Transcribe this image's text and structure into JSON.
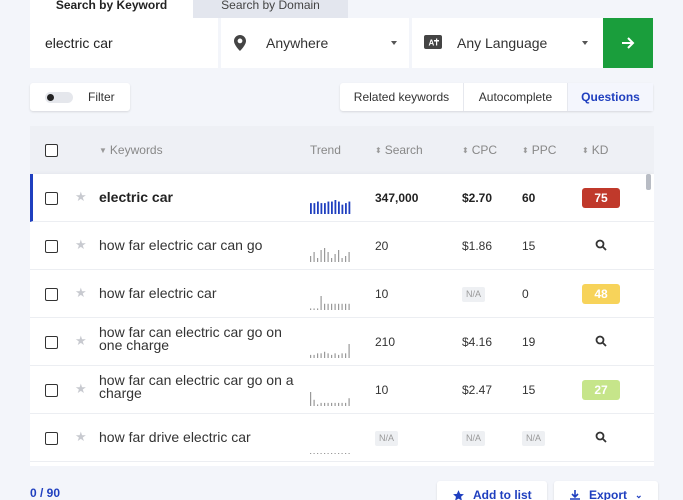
{
  "tabs": {
    "active": "Search by Keyword",
    "inactive": "Search by Domain"
  },
  "search": {
    "keyword_value": "electric car",
    "location": "Anywhere",
    "language": "Any Language"
  },
  "icons": {
    "location": "map-pin-icon",
    "language": "translate-icon",
    "go": "arrow-right-icon",
    "star": "star-icon",
    "search": "magnifier-icon",
    "add": "star-icon",
    "export": "download-icon"
  },
  "colors": {
    "go_button": "#1a9e3c",
    "accent": "#1f3fbf"
  },
  "filter": {
    "label": "Filter"
  },
  "modes": [
    "Related keywords",
    "Autocomplete",
    "Questions"
  ],
  "modes_selected": "Questions",
  "table": {
    "headers": {
      "keywords": "Keywords",
      "trend": "Trend",
      "search": "Search",
      "cpc": "CPC",
      "ppc": "PPC",
      "kd": "KD"
    },
    "rows": [
      {
        "keyword": "electric car",
        "search": "347,000",
        "cpc": "$2.70",
        "ppc": "60",
        "kd": "75",
        "kd_color": "#c0392b",
        "trend": [
          7,
          7,
          8,
          7,
          7,
          8,
          8,
          9,
          8,
          6,
          7,
          8
        ]
      },
      {
        "keyword": "how far electric car can go",
        "search": "20",
        "cpc": "$1.86",
        "ppc": "15",
        "kd": "",
        "kd_color": "",
        "trend": [
          3,
          5,
          2,
          6,
          7,
          5,
          2,
          4,
          6,
          2,
          3,
          5
        ]
      },
      {
        "keyword": "how far electric car",
        "search": "10",
        "cpc": "N/A",
        "ppc": "0",
        "kd": "48",
        "kd_color": "#f7d35a",
        "trend": [
          1,
          1,
          1,
          9,
          4,
          4,
          4,
          4,
          4,
          4,
          4,
          4
        ]
      },
      {
        "keyword": "how far can electric car go on one charge",
        "search": "210",
        "cpc": "$4.16",
        "ppc": "19",
        "kd": "",
        "kd_color": "",
        "trend": [
          2,
          2,
          3,
          3,
          4,
          3,
          2,
          3,
          2,
          3,
          3,
          9
        ]
      },
      {
        "keyword": "how far can electric car go on a charge",
        "search": "10",
        "cpc": "$2.47",
        "ppc": "15",
        "kd": "27",
        "kd_color": "#c6e58a",
        "trend": [
          9,
          4,
          1,
          2,
          2,
          2,
          2,
          2,
          2,
          2,
          2,
          5
        ]
      },
      {
        "keyword": "how far drive electric car",
        "search": "N/A",
        "cpc": "N/A",
        "ppc": "N/A",
        "kd": "",
        "kd_color": "",
        "trend": []
      }
    ]
  },
  "footer": {
    "count": "0 / 90",
    "add_to_list": "Add to list",
    "export": "Export"
  }
}
